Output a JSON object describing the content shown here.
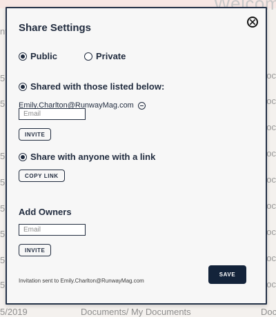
{
  "background": {
    "top_right_title": "Welcom",
    "left_texts": [
      "nt",
      "5",
      "5",
      "5",
      "5",
      "5",
      "5",
      "5",
      "5"
    ],
    "right_texts": [
      "oc",
      "oc",
      "oc",
      "oc",
      "oc",
      "oc",
      "oc",
      "oc",
      "oc"
    ],
    "footer": {
      "date": "5/2019",
      "path": "Documents/ My Documents",
      "right": "Doc"
    }
  },
  "modal": {
    "title": "Share Settings",
    "visibility": {
      "public_label": "Public",
      "private_label": "Private",
      "selected": "Public"
    },
    "shared_listed_label": "Shared with those listed below:",
    "shared_email": "Emily.Charlton@RunwayMag.com",
    "email_placeholder": "Email",
    "invite_label": "INVITE",
    "share_link_label": "Share with anyone with a link",
    "copy_link_label": "COPY LINK",
    "add_owners_label": "Add Owners",
    "owners_email_placeholder": "Email",
    "owners_invite_label": "INVITE",
    "footer_note": "Invitation sent to Emily.Charlton@RunwayMag.com",
    "save_label": "SAVE"
  }
}
